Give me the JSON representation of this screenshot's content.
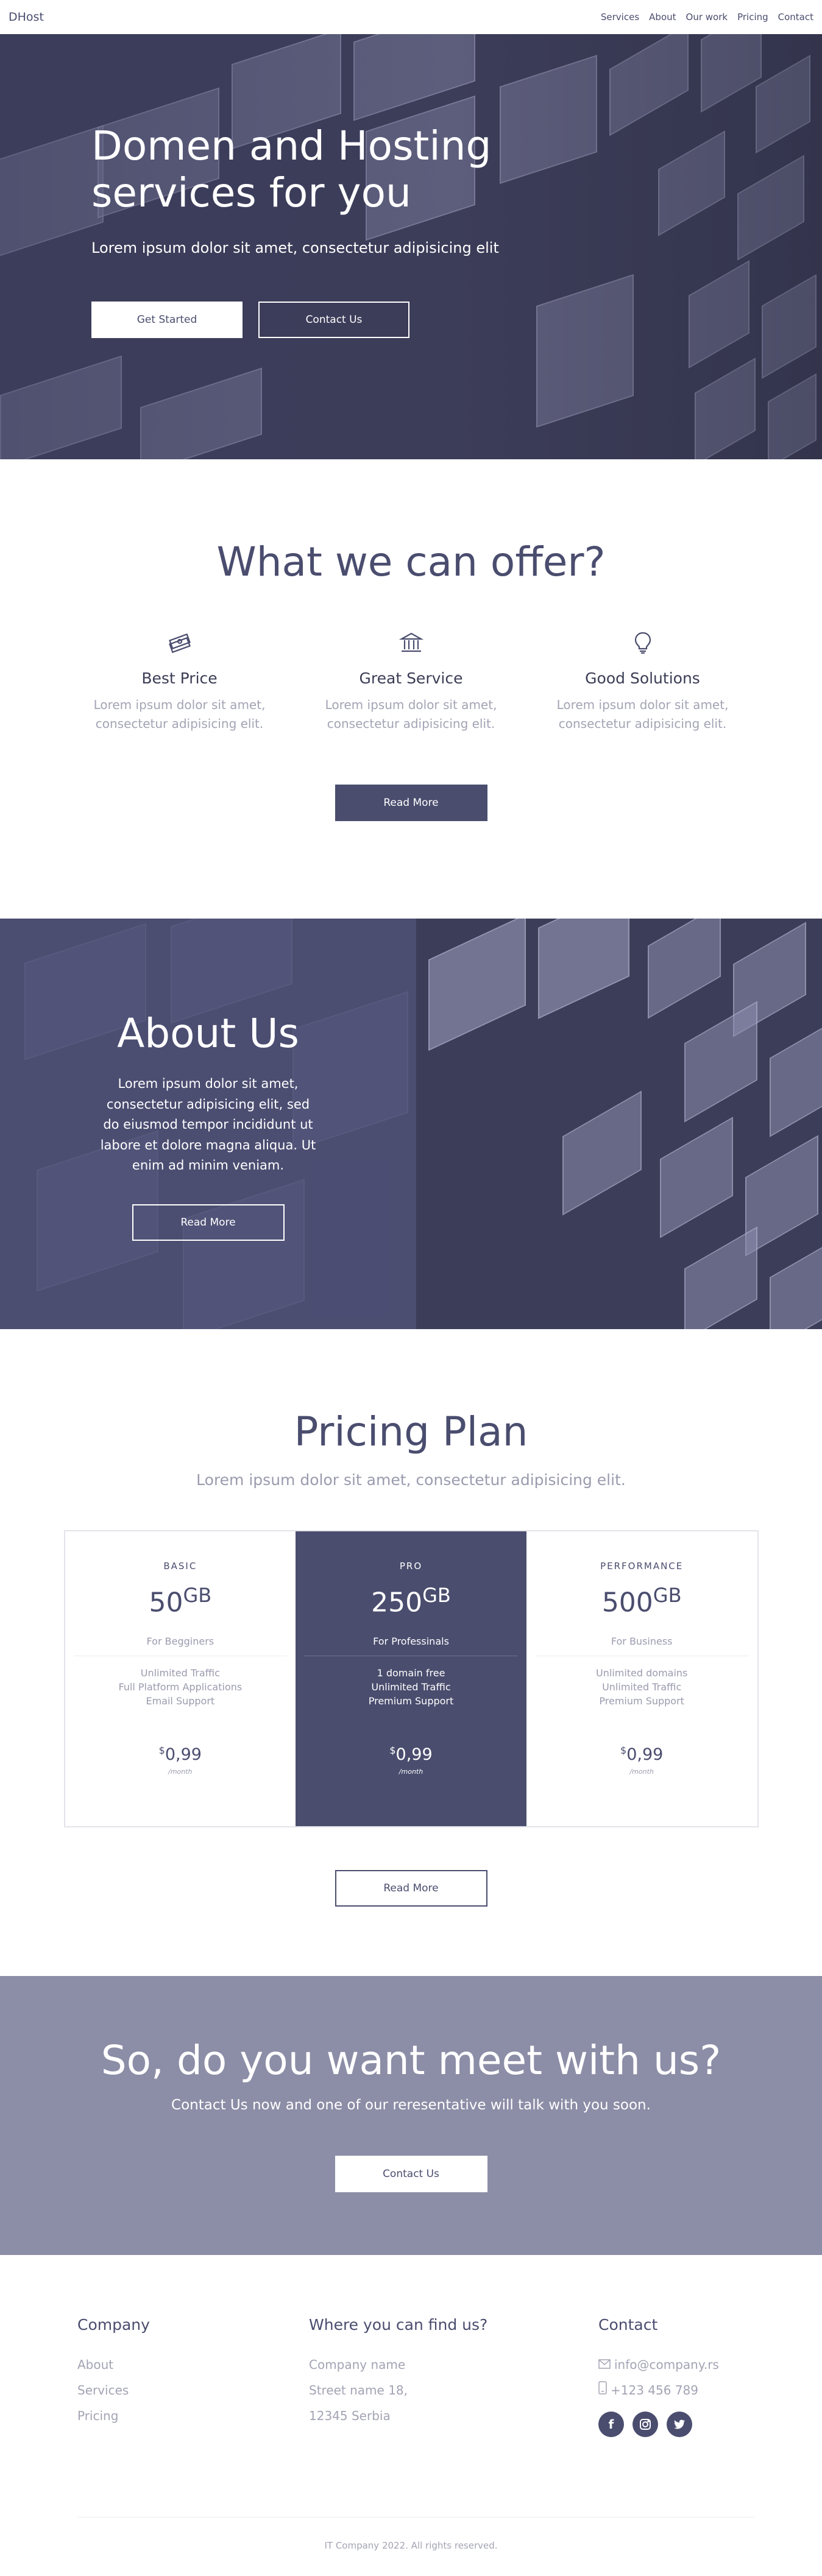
{
  "nav": {
    "brand": "DHost",
    "links": [
      "Services",
      "About",
      "Our work",
      "Pricing",
      "Contact"
    ]
  },
  "hero": {
    "title": "Domen and Hosting services for you",
    "subtitle": "Lorem ipsum dolor sit amet, consectetur adipisicing elit",
    "primary_button": "Get Started",
    "secondary_button": "Contact Us"
  },
  "offer": {
    "title": "What we can offer?",
    "features": [
      {
        "icon": "money-icon",
        "title": "Best Price",
        "text": "Lorem ipsum dolor sit amet, consectetur adipisicing elit."
      },
      {
        "icon": "bank-icon",
        "title": "Great Service",
        "text": "Lorem ipsum dolor sit amet, consectetur adipisicing elit."
      },
      {
        "icon": "lightbulb-icon",
        "title": "Good Solutions",
        "text": "Lorem ipsum dolor sit amet, consectetur adipisicing elit."
      }
    ],
    "button": "Read More"
  },
  "about": {
    "title": "About Us",
    "text": "Lorem ipsum dolor sit amet, consectetur adipisicing elit, sed do eiusmod tempor incididunt ut labore et dolore magna aliqua. Ut enim ad minim veniam.",
    "button": "Read More"
  },
  "pricing": {
    "title": "Pricing Plan",
    "subtitle": "Lorem ipsum dolor sit amet, consectetur adipisicing elit.",
    "plans": [
      {
        "name": "BASIC",
        "size": "50",
        "unit": "GB",
        "for": "For Begginers",
        "features": [
          "Unlimited Traffic",
          "Full Platform Applications",
          "Email Support"
        ],
        "currency": "$",
        "price": "0,99",
        "period": "/month"
      },
      {
        "name": "PRO",
        "size": "250",
        "unit": "GB",
        "for": "For Professinals",
        "features": [
          "1 domain free",
          "Unlimited Traffic",
          "Premium Support"
        ],
        "currency": "$",
        "price": "0,99",
        "period": "/month"
      },
      {
        "name": "PERFORMANCE",
        "size": "500",
        "unit": "GB",
        "for": "For Business",
        "features": [
          "Unlimited domains",
          "Unlimited Traffic",
          "Premium Support"
        ],
        "currency": "$",
        "price": "0,99",
        "period": "/month"
      }
    ],
    "button": "Read More"
  },
  "cta": {
    "title": "So, do you want meet with us?",
    "subtitle": "Contact Us now and one of our reresentative will talk with you soon.",
    "button": "Contact Us"
  },
  "footer": {
    "col1": {
      "title": "Company",
      "links": [
        "About",
        "Services",
        "Pricing"
      ]
    },
    "col2": {
      "title": "Where you can find us?",
      "lines": [
        "Company name",
        "Street name 18,",
        "12345 Serbia"
      ]
    },
    "col3": {
      "title": "Contact",
      "email": "info@company.rs",
      "phone": "+123 456 789",
      "socials": [
        "facebook-icon",
        "instagram-icon",
        "twitter-icon"
      ]
    },
    "copyright": "IT Company 2022. All rights reserved."
  },
  "colors": {
    "primary": "#4a4d6e",
    "cta_bg": "#8c8da6",
    "muted_text": "#a3a4b4"
  }
}
